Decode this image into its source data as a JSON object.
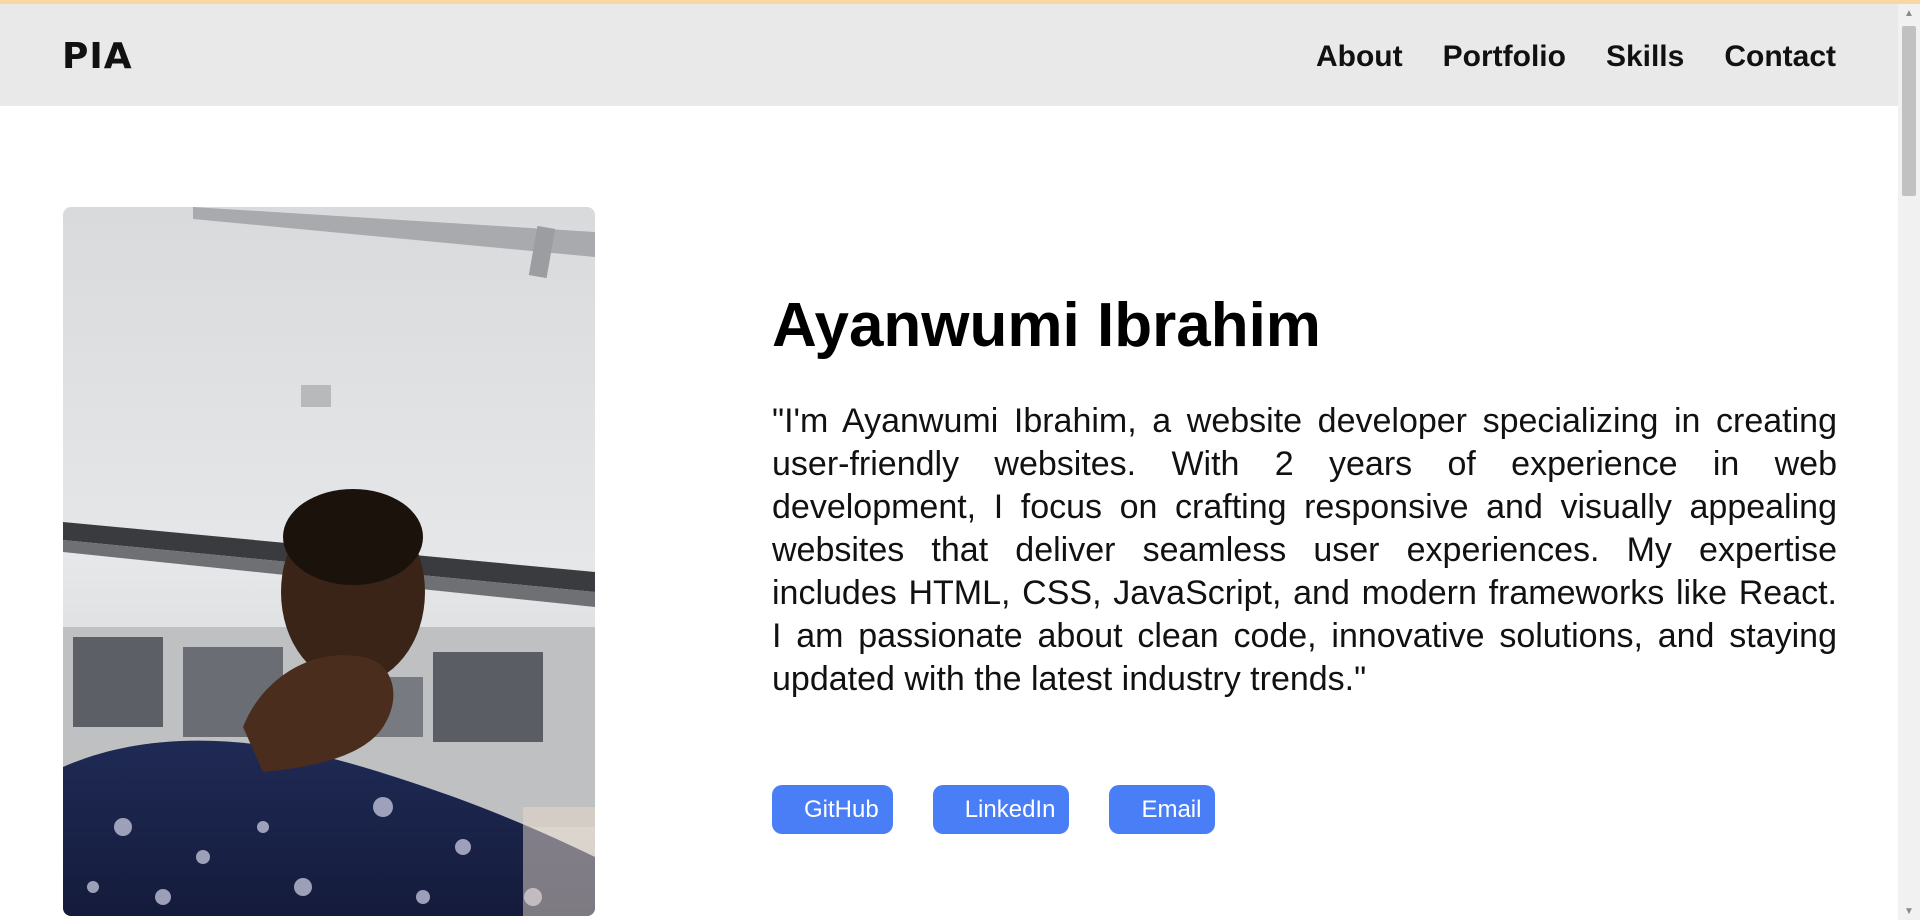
{
  "header": {
    "logo": "PIA",
    "nav": [
      "About",
      "Portfolio",
      "Skills",
      "Contact"
    ]
  },
  "hero": {
    "name": "Ayanwumi Ibrahim",
    "bio": "\"I'm Ayanwumi Ibrahim, a website developer specializing in creating user-friendly websites. With 2 years of experience in web development, I focus on crafting responsive and visually appealing websites that deliver seamless user experiences. My expertise includes HTML, CSS, JavaScript, and modern frameworks like React. I am passionate about clean code, innovative solutions, and staying updated with the latest industry trends.\"",
    "links": [
      "GitHub",
      "LinkedIn",
      "Email"
    ]
  },
  "colors": {
    "navbar_bg": "#e9e9ea",
    "button_bg": "#4a7ef7",
    "top_strip": "#f7d7a6"
  }
}
